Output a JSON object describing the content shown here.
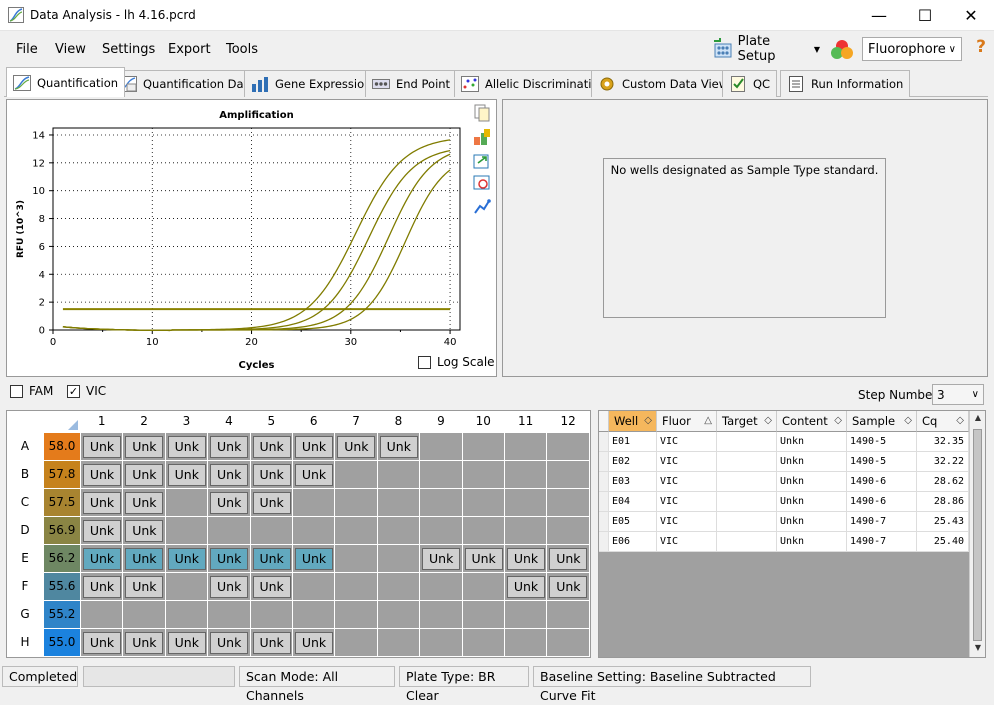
{
  "window": {
    "title": "Data Analysis - lh 4.16.pcrd"
  },
  "menu": [
    "File",
    "View",
    "Settings",
    "Export",
    "Tools"
  ],
  "toolbar": {
    "plate_setup": "Plate Setup",
    "fluorophore": "Fluorophore"
  },
  "tabs": [
    "Quantification",
    "Quantification Data",
    "Gene Expression",
    "End Point",
    "Allelic Discrimination",
    "Custom Data View",
    "QC",
    "Run Information"
  ],
  "chart_data": {
    "type": "line",
    "title": "Amplification",
    "xlabel": "Cycles",
    "ylabel": "RFU (10^3)",
    "xlim": [
      0,
      41
    ],
    "ylim": [
      0,
      14.5
    ],
    "x_ticks": [
      "0",
      "10",
      "20",
      "30",
      "40"
    ],
    "y_ticks": [
      "0",
      "2",
      "4",
      "6",
      "8",
      "10",
      "12",
      "14"
    ],
    "threshold": 1.5,
    "series": [
      {
        "plateau": 13.9,
        "mid": 30.5,
        "k": 0.42
      },
      {
        "plateau": 13.2,
        "mid": 31.8,
        "k": 0.45
      },
      {
        "plateau": 13.3,
        "mid": 33.8,
        "k": 0.47
      },
      {
        "plateau": 12.7,
        "mid": 35.5,
        "k": 0.5
      }
    ]
  },
  "chart": {
    "log_scale": "Log Scale"
  },
  "side": {
    "message": "No wells designated as Sample Type standard."
  },
  "fluors": {
    "fam": "FAM",
    "vic": "VIC",
    "step_label": "Step Number:",
    "step_value": "3"
  },
  "plate": {
    "columns": [
      "1",
      "2",
      "3",
      "4",
      "5",
      "6",
      "7",
      "8",
      "9",
      "10",
      "11",
      "12"
    ],
    "rows": [
      {
        "label": "A",
        "temp": "58.0",
        "color": "#e47b1b",
        "wells": [
          "Unk",
          "Unk",
          "Unk",
          "Unk",
          "Unk",
          "Unk",
          "Unk",
          "Unk",
          "",
          "",
          "",
          ""
        ]
      },
      {
        "label": "B",
        "temp": "57.8",
        "color": "#c6821c",
        "wells": [
          "Unk",
          "Unk",
          "Unk",
          "Unk",
          "Unk",
          "Unk",
          "",
          "",
          "",
          "",
          "",
          ""
        ]
      },
      {
        "label": "C",
        "temp": "57.5",
        "color": "#a88430",
        "wells": [
          "Unk",
          "Unk",
          "",
          "Unk",
          "Unk",
          "",
          "",
          "",
          "",
          "",
          "",
          ""
        ]
      },
      {
        "label": "D",
        "temp": "56.9",
        "color": "#8a8544",
        "wells": [
          "Unk",
          "Unk",
          "",
          "",
          "",
          "",
          "",
          "",
          "",
          "",
          "",
          ""
        ]
      },
      {
        "label": "E",
        "temp": "56.2",
        "color": "#6e8763",
        "wells": [
          "Unk",
          "Unk",
          "Unk",
          "Unk",
          "Unk",
          "Unk",
          "",
          "",
          "Unk",
          "Unk",
          "Unk",
          "Unk"
        ]
      },
      {
        "label": "F",
        "temp": "55.6",
        "color": "#4f87a0",
        "wells": [
          "Unk",
          "Unk",
          "",
          "Unk",
          "Unk",
          "",
          "",
          "",
          "",
          "",
          "Unk",
          "Unk"
        ]
      },
      {
        "label": "G",
        "temp": "55.2",
        "color": "#2f84c8",
        "wells": [
          "",
          "",
          "",
          "",
          "",
          "",
          "",
          "",
          "",
          "",
          "",
          ""
        ]
      },
      {
        "label": "H",
        "temp": "55.0",
        "color": "#1b82de",
        "wells": [
          "Unk",
          "Unk",
          "Unk",
          "Unk",
          "Unk",
          "Unk",
          "",
          "",
          "",
          "",
          "",
          ""
        ]
      }
    ],
    "selected_row": "E",
    "selected_wells": [
      "1",
      "2",
      "3",
      "4",
      "5",
      "6"
    ]
  },
  "table": {
    "headers": [
      "Well",
      "Fluor",
      "Target",
      "Content",
      "Sample",
      "Cq"
    ],
    "rows": [
      [
        "E01",
        "VIC",
        "",
        "Unkn",
        "1490-5",
        "32.35"
      ],
      [
        "E02",
        "VIC",
        "",
        "Unkn",
        "1490-5",
        "32.22"
      ],
      [
        "E03",
        "VIC",
        "",
        "Unkn",
        "1490-6",
        "28.62"
      ],
      [
        "E04",
        "VIC",
        "",
        "Unkn",
        "1490-6",
        "28.86"
      ],
      [
        "E05",
        "VIC",
        "",
        "Unkn",
        "1490-7",
        "25.43"
      ],
      [
        "E06",
        "VIC",
        "",
        "Unkn",
        "1490-7",
        "25.40"
      ]
    ]
  },
  "status": {
    "completed": "Completed",
    "scan_mode": "Scan Mode: All Channels",
    "plate_type": "Plate Type: BR Clear",
    "baseline": "Baseline Setting: Baseline Subtracted Curve Fit"
  }
}
